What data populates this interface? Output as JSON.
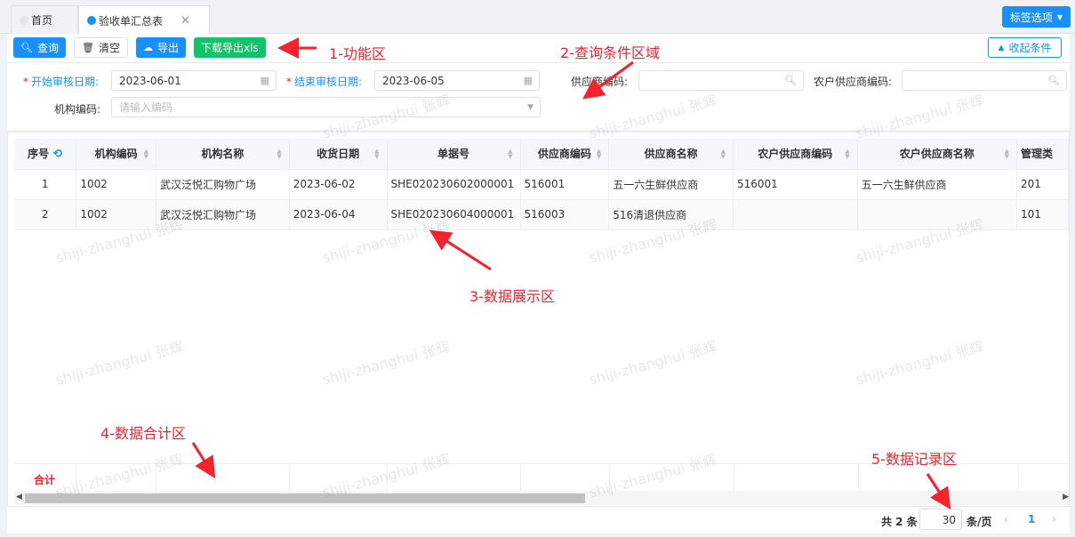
{
  "tabs": [
    {
      "label": "首页",
      "active": false
    },
    {
      "label": "验收单汇总表",
      "active": true,
      "close": "✕"
    }
  ],
  "tag_options_label": "标签选项",
  "toolbar": {
    "query_label": "查询",
    "clear_label": "清空",
    "export_label": "导出",
    "download_xls_label": "下载导出xls",
    "collapse_label": "收起条件"
  },
  "filters": {
    "start_label": "开始审核日期:",
    "start_value": "2023-06-01",
    "end_label": "结束审核日期:",
    "end_value": "2023-06-05",
    "supplier_code_label": "供应商编码:",
    "farmer_supplier_code_label": "农户供应商编码:",
    "org_code_label": "机构编码:",
    "org_code_placeholder": "请输入编码"
  },
  "table": {
    "columns": [
      "序号",
      "机构编码",
      "机构名称",
      "收货日期",
      "单据号",
      "供应商编码",
      "供应商名称",
      "农户供应商编码",
      "农户供应商名称",
      "管理类"
    ],
    "rows": [
      [
        "1",
        "1002",
        "武汉泛悦汇购物广场",
        "2023-06-02",
        "SHE020230602000001",
        "516001",
        "五一六生鲜供应商",
        "516001",
        "五一六生鲜供应商",
        "201"
      ],
      [
        "2",
        "1002",
        "武汉泛悦汇购物广场",
        "2023-06-04",
        "SHE020230604000001",
        "516003",
        "516清退供应商",
        "",
        "",
        "101"
      ]
    ],
    "summary_label": "合计"
  },
  "pager": {
    "total": "共 2 条",
    "page_size": "30",
    "unit": "条/页",
    "current_page": "1"
  },
  "annotations": {
    "a1": "1-功能区",
    "a2": "2-查询条件区域",
    "a3": "3-数据展示区",
    "a4": "4-数据合计区",
    "a5": "5-数据记录区"
  },
  "watermark": "shiji-zhanghui 张辉",
  "colors": {
    "primary": "#1890ff",
    "success": "#13c26a",
    "danger": "#f5222d"
  }
}
